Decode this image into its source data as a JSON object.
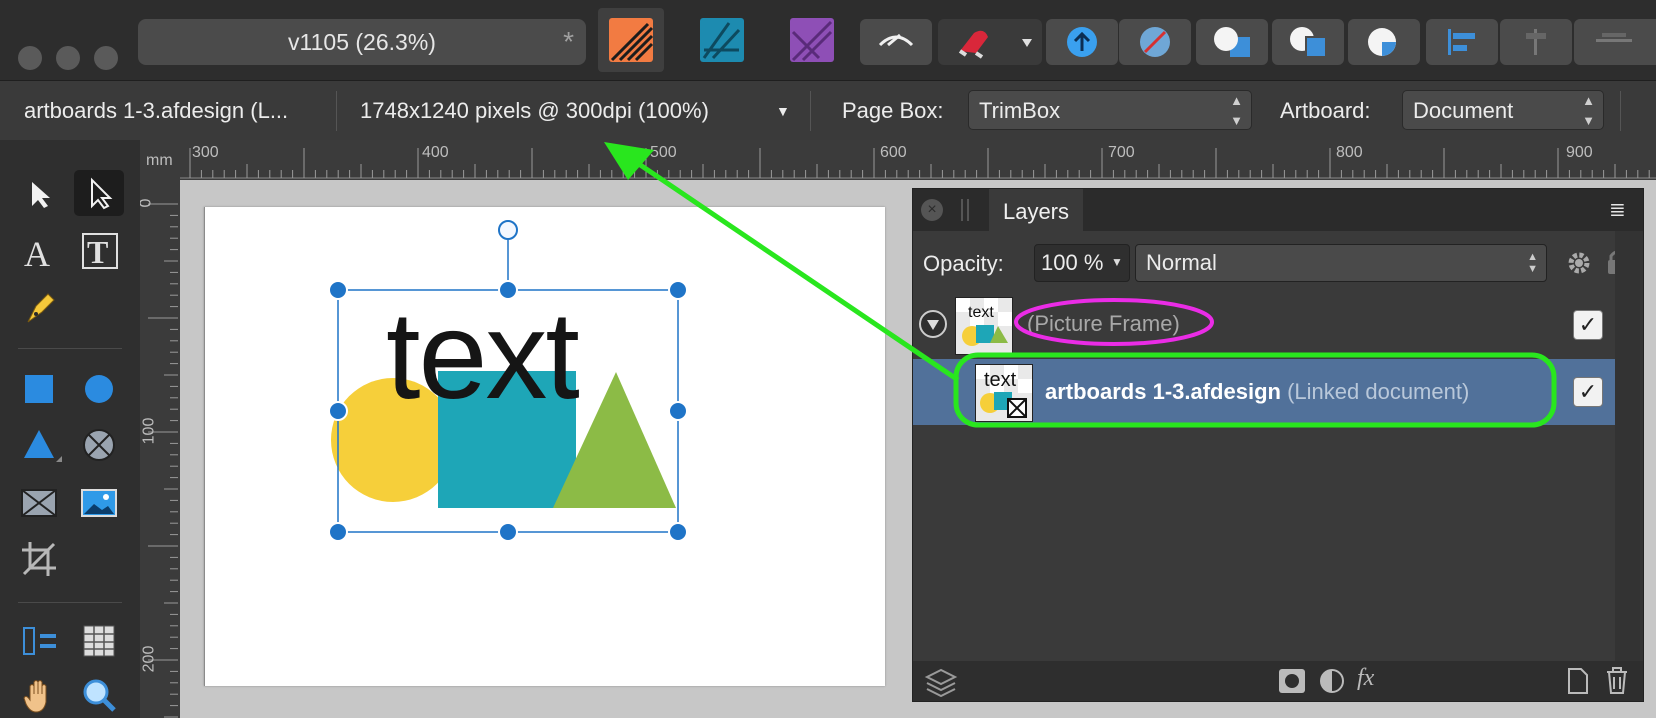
{
  "window": {
    "doc_title": "v1105  (26.3%)",
    "modified_marker": "*"
  },
  "context_bar": {
    "document_name": "artboards 1-3.afdesign (L...",
    "document_info": "1748x1240 pixels @ 300dpi (100%)",
    "page_box_label": "Page Box:",
    "page_box_value": "TrimBox",
    "artboard_label": "Artboard:",
    "artboard_value": "Document"
  },
  "ruler": {
    "unit": "mm",
    "top_ticks": [
      "300",
      "400",
      "500",
      "600",
      "700",
      "800",
      "900"
    ],
    "left_ticks": [
      "0",
      "100",
      "200"
    ]
  },
  "canvas": {
    "text": "text"
  },
  "layers_panel": {
    "tab_label": "Layers",
    "opacity_label": "Opacity:",
    "opacity_value": "100 %",
    "blend_mode": "Normal",
    "layers": [
      {
        "name": "(Picture Frame)",
        "checked": "✓",
        "thumb_text": "text"
      },
      {
        "name": "artboards 1-3.afdesign",
        "suffix": "(Linked document)",
        "checked": "✓",
        "thumb_text": "text"
      }
    ]
  },
  "colors": {
    "selection": "#1f74c7",
    "annotation_green": "#29e61e",
    "annotation_magenta": "#ea2ce6",
    "accent_row": "#51719a"
  }
}
